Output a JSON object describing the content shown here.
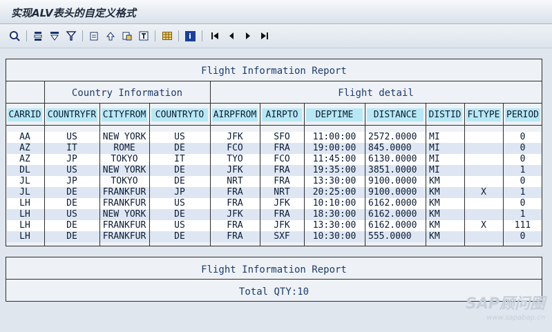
{
  "window": {
    "title": "实现ALV表头的自定义格式"
  },
  "toolbar": {
    "icons": [
      "details-icon",
      "sort-ascending-icon",
      "sort-descending-icon",
      "filter-icon",
      "export-icon",
      "print-icon",
      "print-preview-icon",
      "send-icon",
      "layout-icon",
      "info-icon",
      "first-page-icon",
      "previous-page-icon",
      "next-page-icon",
      "last-page-icon"
    ]
  },
  "report": {
    "title": "Flight Information Report",
    "group_country": "Country Information",
    "group_flight": "Flight detail",
    "columns": [
      "CARRID",
      "COUNTRYFR",
      "CITYFROM",
      "COUNTRYTO",
      "AIRPFROM",
      "AIRPTO",
      "DEPTIME",
      "DISTANCE",
      "DISTID",
      "FLTYPE",
      "PERIOD"
    ],
    "rows": [
      [
        "AA",
        "US",
        "NEW YORK",
        "US",
        "JFK",
        "SFO",
        "11:00:00",
        "2572.0000",
        "MI",
        "",
        "0"
      ],
      [
        "AZ",
        "IT",
        "ROME",
        "DE",
        "FCO",
        "FRA",
        "19:00:00",
        "845.0000",
        "MI",
        "",
        "0"
      ],
      [
        "AZ",
        "JP",
        "TOKYO",
        "IT",
        "TYO",
        "FCO",
        "11:45:00",
        "6130.0000",
        "MI",
        "",
        "0"
      ],
      [
        "DL",
        "US",
        "NEW YORK",
        "DE",
        "JFK",
        "FRA",
        "19:35:00",
        "3851.0000",
        "MI",
        "",
        "1"
      ],
      [
        "JL",
        "JP",
        "TOKYO",
        "DE",
        "NRT",
        "FRA",
        "13:30:00",
        "9100.0000",
        "KM",
        "",
        "0"
      ],
      [
        "JL",
        "DE",
        "FRANKFUR",
        "JP",
        "FRA",
        "NRT",
        "20:25:00",
        "9100.0000",
        "KM",
        "X",
        "1"
      ],
      [
        "LH",
        "DE",
        "FRANKFUR",
        "US",
        "FRA",
        "JFK",
        "10:10:00",
        "6162.0000",
        "KM",
        "",
        "0"
      ],
      [
        "LH",
        "US",
        "NEW YORK",
        "DE",
        "JFK",
        "FRA",
        "18:30:00",
        "6162.0000",
        "KM",
        "",
        "1"
      ],
      [
        "LH",
        "DE",
        "FRANKFUR",
        "US",
        "FRA",
        "JFK",
        "13:30:00",
        "6162.0000",
        "KM",
        "X",
        "111"
      ],
      [
        "LH",
        "DE",
        "FRANKFUR",
        "DE",
        "FRA",
        "SXF",
        "10:30:00",
        "555.0000",
        "KM",
        "",
        "0"
      ]
    ]
  },
  "footer": {
    "title": "Flight Information Report",
    "total": "Total QTY:10"
  },
  "watermark": {
    "brand": "SAP顾问圈",
    "url": "www.sapabap.cn"
  }
}
